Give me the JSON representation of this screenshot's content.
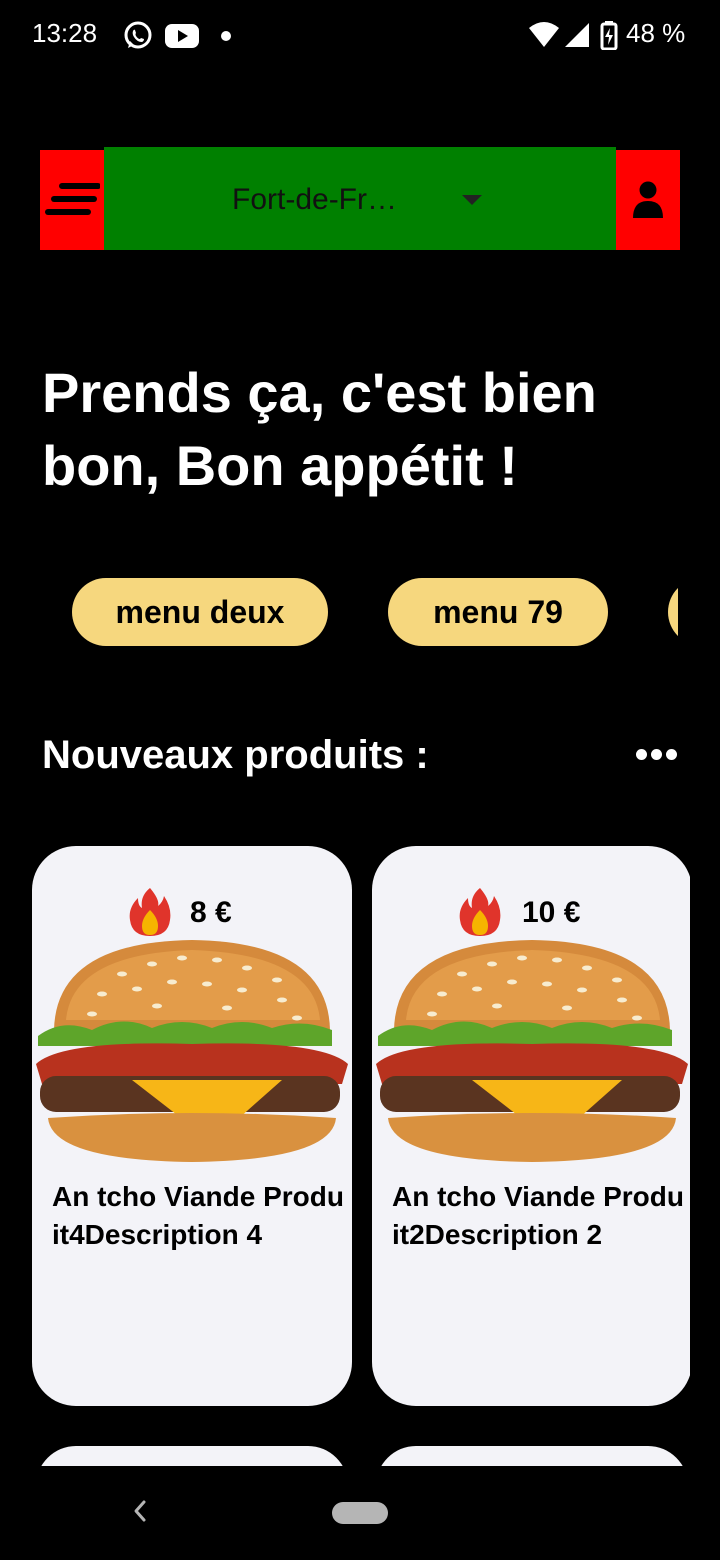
{
  "status_bar": {
    "time": "13:28",
    "battery": "48 %",
    "icons": [
      "whatsapp-icon",
      "youtube-icon",
      "notification-dot-icon",
      "wifi-icon",
      "signal-icon",
      "battery-charging-icon"
    ]
  },
  "header": {
    "location": "Fort-de-Fr…",
    "colors": {
      "sides": "#ff0000",
      "location_bg": "#008000"
    }
  },
  "headline": "Prends ça, c'est bien bon, Bon appétit !",
  "menus": [
    {
      "label": "menu deux"
    },
    {
      "label": "menu 79"
    },
    {
      "label": ""
    }
  ],
  "section": {
    "title": "Nouveaux produits :"
  },
  "products": [
    {
      "price": "8 €",
      "title": "An tcho Viande Produit4Description 4"
    },
    {
      "price": "10 €",
      "title": "An tcho Viande Produit2Description 2"
    }
  ],
  "colors": {
    "chip": "#f6d77e",
    "card": "#f3f3f8"
  }
}
